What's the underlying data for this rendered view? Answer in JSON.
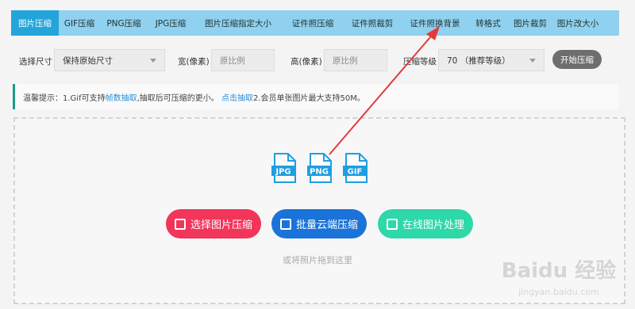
{
  "tabs": [
    {
      "label": "图片压缩",
      "active": true
    },
    {
      "label": "GIF压缩"
    },
    {
      "label": "PNG压缩"
    },
    {
      "label": "JPG压缩"
    },
    {
      "label": "图片压缩指定大小"
    },
    {
      "label": "证件照压缩"
    },
    {
      "label": "证件照裁剪"
    },
    {
      "label": "证件照换背景"
    },
    {
      "label": "转格式"
    },
    {
      "label": "图片裁剪"
    },
    {
      "label": "图片改大小"
    }
  ],
  "options": {
    "size_label": "选择尺寸",
    "size_value": "保持原始尺寸",
    "width_label": "宽(像素)",
    "width_placeholder": "原比例",
    "height_label": "高(像素)",
    "height_placeholder": "原比例",
    "quality_label": "压缩等级",
    "quality_value": "70 （推荐等级）",
    "start_button": "开始压缩"
  },
  "notice": {
    "prefix": "温馨提示：1.Gif可支持",
    "link1": "帧数抽取",
    "mid": ",抽取后可压缩的更小。",
    "link2": "点击抽取",
    "suffix": " 2.会员单张图片最大支持50M。"
  },
  "formats": [
    "JPG",
    "PNG",
    "GIF"
  ],
  "actions": {
    "select_button": "选择图片压缩",
    "batch_button": "批量云端压缩",
    "online_button": "在线图片处理",
    "drop_hint": "或将照片拖到这里"
  },
  "colors": {
    "tab_bar": "#8fd1ef",
    "tab_active": "#23a5da",
    "select_btn": "#f2355a",
    "batch_btn": "#1a73d9",
    "online_btn": "#2ed8a8",
    "arrow": "#e23b3b"
  },
  "watermark": {
    "line1": "Baidu 经验",
    "line2": "jingyan.baidu.com"
  }
}
